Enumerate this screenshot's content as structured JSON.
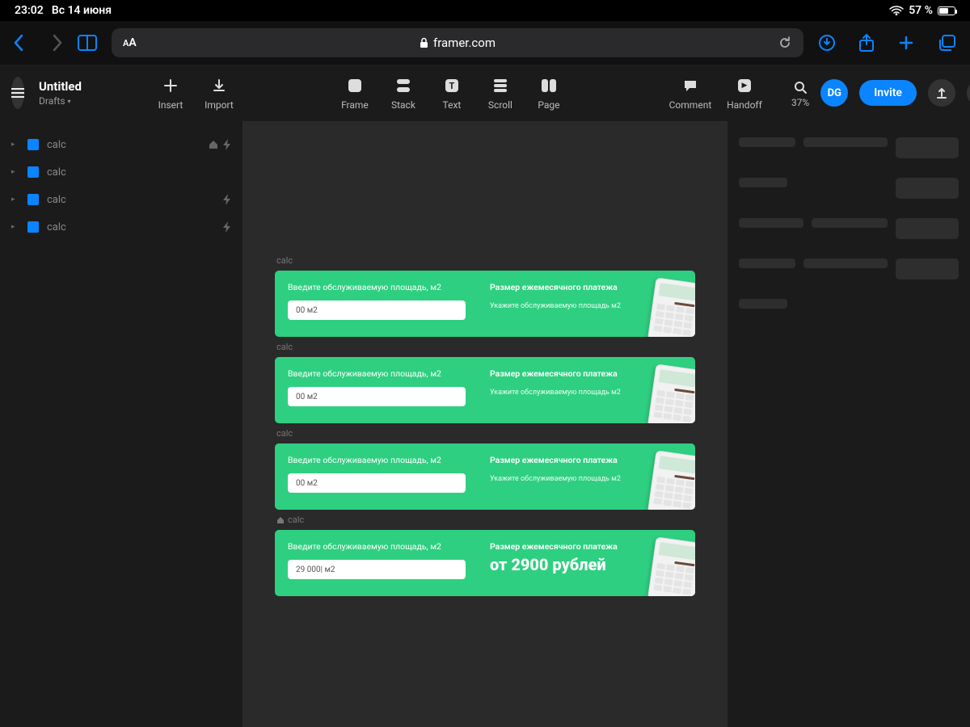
{
  "status": {
    "time": "23:02",
    "date": "Вс 14 июня",
    "battery": "57 %"
  },
  "browser": {
    "domain": "framer.com"
  },
  "framer": {
    "title": "Untitled",
    "location": "Drafts",
    "tools": {
      "insert": "Insert",
      "import": "Import",
      "frame": "Frame",
      "stack": "Stack",
      "text": "Text",
      "scroll": "Scroll",
      "page": "Page",
      "comment": "Comment",
      "handoff": "Handoff"
    },
    "zoom": "37%",
    "avatar": "DG",
    "invite": "Invite"
  },
  "layers": [
    {
      "name": "calc",
      "home": true,
      "bolt": true
    },
    {
      "name": "calc",
      "home": false,
      "bolt": false
    },
    {
      "name": "calc",
      "home": false,
      "bolt": true
    },
    {
      "name": "calc",
      "home": false,
      "bolt": true
    }
  ],
  "frames": [
    {
      "label": "calc",
      "home": false,
      "input": "00 м2",
      "left_label": "Введите обслуживаемую площадь, м2",
      "right_label": "Размер ежемесячного платежа",
      "right_sub": "Укажите обслуживаемую площадь м2",
      "result": ""
    },
    {
      "label": "calc",
      "home": false,
      "input": "00 м2",
      "left_label": "Введите обслуживаемую площадь, м2",
      "right_label": "Размер ежемесячного платежа",
      "right_sub": "Укажите обслуживаемую площадь м2",
      "result": ""
    },
    {
      "label": "calc",
      "home": false,
      "input": "00 м2",
      "left_label": "Введите обслуживаемую площадь, м2",
      "right_label": "Размер ежемесячного платежа",
      "right_sub": "Укажите обслуживаемую площадь м2",
      "result": ""
    },
    {
      "label": "calc",
      "home": true,
      "input": "29 000| м2",
      "left_label": "Введите обслуживаемую площадь, м2",
      "right_label": "Размер ежемесячного платежа",
      "right_sub": "",
      "result": "от 2900 рублей"
    }
  ]
}
